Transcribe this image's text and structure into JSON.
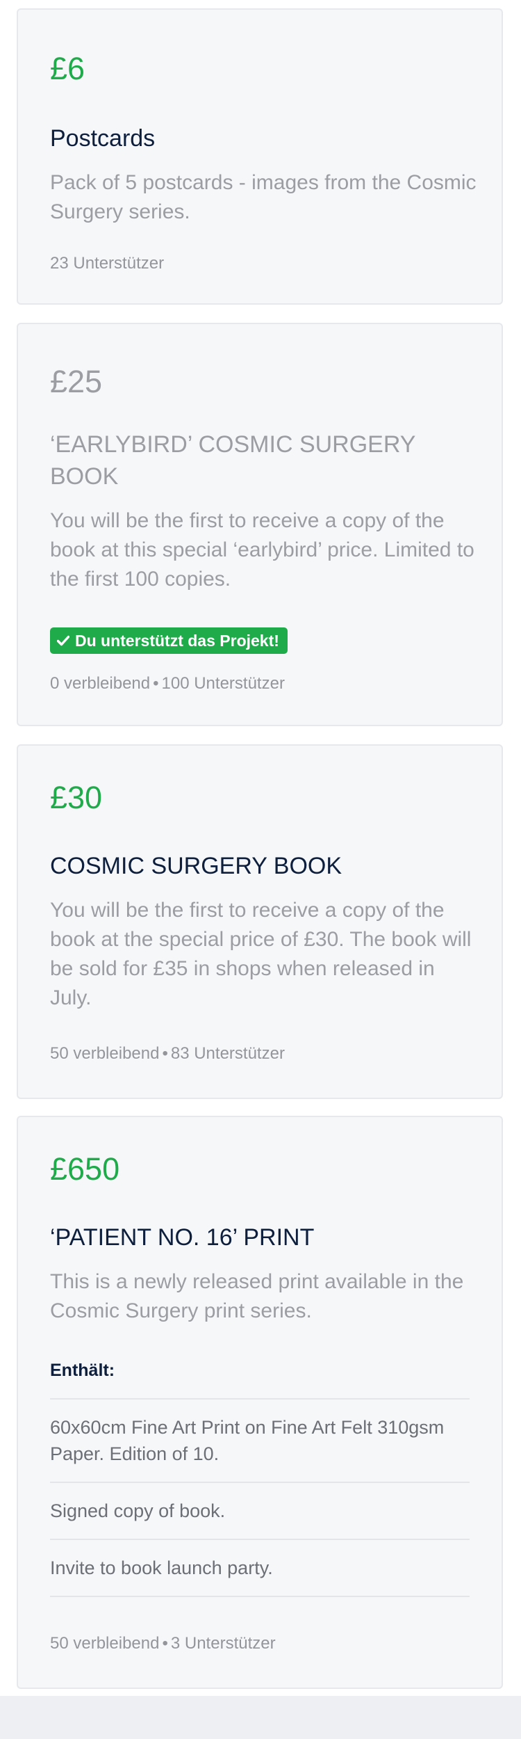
{
  "rewards": [
    {
      "price": "£6",
      "title": "Postcards",
      "description": "Pack of 5 postcards - images from the Cosmic Surgery series.",
      "backers": "23 Unterstützer"
    },
    {
      "price": "£25",
      "title": "‘EARLYBIRD’ COSMIC SURGERY BOOK",
      "description": "You will be the first to receive a copy of the book at this special ‘earlybird’ price. Limited to the first 100 copies.",
      "badge": "Du unterstützt das Projekt!",
      "remaining": "0 verbleibend",
      "backers": "100 Unterstützer"
    },
    {
      "price": "£30",
      "title": "COSMIC SURGERY BOOK",
      "description": "You will be the first to receive a copy of the book at the special price of £30. The book will be sold for £35 in shops when released in July.",
      "remaining": "50 verbleibend",
      "backers": "83 Unterstützer"
    },
    {
      "price": "£650",
      "title": "‘PATIENT NO. 16’ PRINT",
      "description": "This is a newly released print available in the Cosmic Surgery print series.",
      "includes_label": "Enthält:",
      "includes": [
        "60x60cm Fine Art Print on Fine Art Felt 310gsm Paper. Edition of 10.",
        "Signed copy of book.",
        "Invite to book launch party."
      ],
      "remaining": "50 verbleibend",
      "backers": "3 Unterstützer"
    }
  ],
  "separator": "•",
  "colors": {
    "price_green": "#1fab4a",
    "muted_gray": "#9b9da3",
    "title_navy": "#0d1f3c",
    "card_bg": "#f6f7f9",
    "badge_green": "#1fab4a"
  },
  "icons": {
    "badge": "checkmark-icon"
  }
}
